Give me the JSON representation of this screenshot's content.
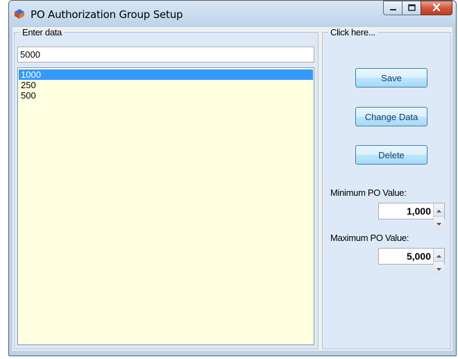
{
  "window": {
    "title": "PO Authorization Group Setup",
    "icon": "app-shield-icon",
    "controls": [
      "minimize-icon",
      "maximize-icon",
      "close-icon"
    ]
  },
  "data_panel": {
    "legend": "Enter data",
    "input_value": "5000",
    "list_items": [
      "1000",
      "250",
      "500"
    ],
    "selected_index": 0
  },
  "actions_panel": {
    "legend": "Click here...",
    "save_label": "Save",
    "change_label": "Change Data",
    "delete_label": "Delete",
    "min_label": "Minimum PO Value:",
    "min_value": "1,000",
    "max_label": "Maximum PO Value:",
    "max_value": "5,000"
  },
  "colors": {
    "list_background": "#ffffe1",
    "selection": "#3399ff",
    "panel_background": "#dde9f6",
    "close_button": "#c9452a"
  }
}
